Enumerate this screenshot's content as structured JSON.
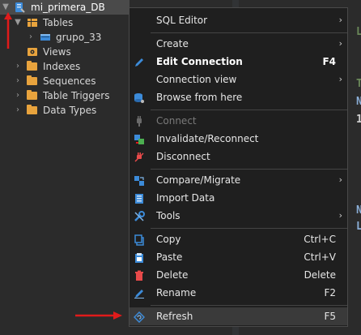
{
  "tree": {
    "db_name": "mi_primera_DB",
    "tables_label": "Tables",
    "table_item": "grupo_33",
    "views_label": "Views",
    "folders": [
      "Indexes",
      "Sequences",
      "Table Triggers",
      "Data Types"
    ]
  },
  "menu": {
    "sql_editor": "SQL Editor",
    "create": "Create",
    "edit_connection": "Edit Connection",
    "edit_connection_shortcut": "F4",
    "connection_view": "Connection view",
    "browse_from_here": "Browse from here",
    "connect": "Connect",
    "invalidate_reconnect": "Invalidate/Reconnect",
    "disconnect": "Disconnect",
    "compare_migrate": "Compare/Migrate",
    "import_data": "Import Data",
    "tools": "Tools",
    "copy": "Copy",
    "copy_shortcut": "Ctrl+C",
    "paste": "Paste",
    "paste_shortcut": "Ctrl+V",
    "delete": "Delete",
    "delete_shortcut": "Delete",
    "rename": "Rename",
    "rename_shortcut": "F2",
    "refresh": "Refresh",
    "refresh_shortcut": "F5"
  },
  "editor_fragments": [
    "L",
    "T",
    "N",
    "1",
    "N",
    "L"
  ],
  "colors": {
    "accent_blue": "#3c8bd9",
    "folder_orange": "#e8a33d",
    "annotation_red": "#e01b1b"
  }
}
